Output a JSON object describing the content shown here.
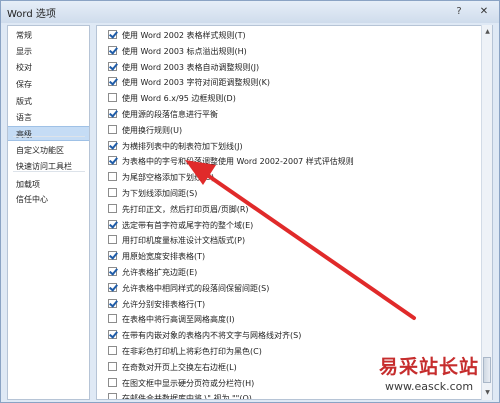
{
  "window": {
    "title": "Word 选项",
    "help_icon": "?",
    "close_icon": "✕"
  },
  "sidebar": {
    "items": [
      {
        "label": "常规"
      },
      {
        "label": "显示"
      },
      {
        "label": "校对"
      },
      {
        "label": "保存"
      },
      {
        "label": "版式"
      },
      {
        "label": "语言"
      },
      {
        "label": "高级",
        "active": true
      },
      {
        "label": "自定义功能区"
      },
      {
        "label": "快速访问工具栏"
      },
      {
        "label": "加载项"
      },
      {
        "label": "信任中心"
      }
    ]
  },
  "options": [
    {
      "label": "使用 Word 2002 表格样式规则(T)",
      "checked": true
    },
    {
      "label": "使用 Word 2003 标点溢出规则(H)",
      "checked": true
    },
    {
      "label": "使用 Word 2003 表格自动调整规则(J)",
      "checked": true
    },
    {
      "label": "使用 Word 2003 字符对间距调整规则(K)",
      "checked": true
    },
    {
      "label": "使用 Word 6.x/95 边框规则(D)",
      "checked": false
    },
    {
      "label": "使用源的段落信息进行平衡",
      "checked": true
    },
    {
      "label": "使用换行规则(U)",
      "checked": false
    },
    {
      "label": "为横排列表中的制表符加下划线(J)",
      "checked": true
    },
    {
      "label": "为表格中的字号和段落调整使用 Word 2002-2007 样式评估规则",
      "checked": true
    },
    {
      "label": "为尾部空格添加下划线(U)",
      "checked": false
    },
    {
      "label": "为下划线添加间距(S)",
      "checked": false
    },
    {
      "label": "先打印正文，然后打印页眉/页脚(R)",
      "checked": false
    },
    {
      "label": "选定带有首字符或尾字符的整个域(E)",
      "checked": true
    },
    {
      "label": "用打印机度量标准设计文档版式(P)",
      "checked": false
    },
    {
      "label": "用原始宽度安排表格(T)",
      "checked": true
    },
    {
      "label": "允许表格扩充边距(E)",
      "checked": true
    },
    {
      "label": "允许表格中相同样式的段落间保留间距(S)",
      "checked": true
    },
    {
      "label": "允许分别安排表格行(T)",
      "checked": true
    },
    {
      "label": "在表格中将行高调至网格高度(I)",
      "checked": false
    },
    {
      "label": "在带有内嵌对象的表格内不将文字与网格线对齐(S)",
      "checked": true
    },
    {
      "label": "在非彩色打印机上将彩色打印为黑色(C)",
      "checked": false
    },
    {
      "label": "在奇数对开页上交换左右边框(L)",
      "checked": false
    },
    {
      "label": "在图文框中显示硬分页符或分栏符(H)",
      "checked": false
    },
    {
      "label": "在邮件合并数据库中将 \\\" 视为 \"\"(Q)",
      "checked": false
    }
  ],
  "watermark": {
    "logo_text": "易采站长站",
    "url": "www.easck.com"
  },
  "colors": {
    "accent": "#1f5ca8",
    "arrow": "#e02a2a",
    "selected": "#c5dcf5"
  }
}
